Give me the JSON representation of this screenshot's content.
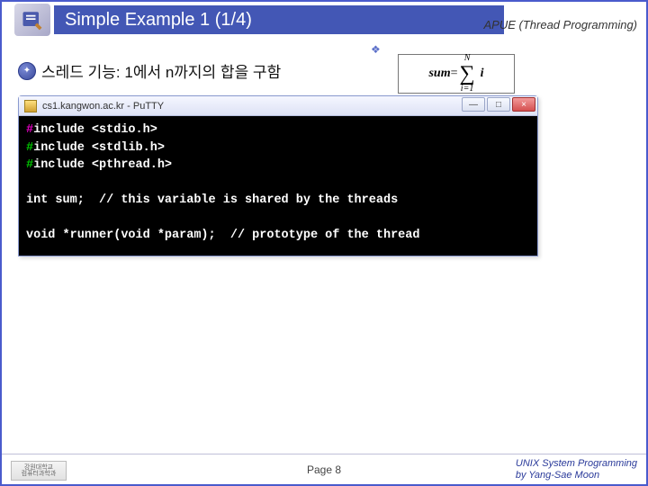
{
  "header": {
    "title": "Simple Example 1 (1/4)",
    "topic": "APUE (Thread Programming)"
  },
  "bullet": {
    "text": "스레드 기능: 1에서 n까지의 합을 구함"
  },
  "formula": {
    "lhs_italic": "sum",
    "eq": " = ",
    "upper": "N",
    "lower": "i=1",
    "rhs": "i"
  },
  "putty": {
    "title": "cs1.kangwon.ac.kr - PuTTY",
    "min_label": "—",
    "max_label": "□",
    "close_label": "×"
  },
  "terminal": {
    "l1_hash": "#",
    "l1_rest": "include <stdio.h>",
    "l2_hash": "#",
    "l2_rest": "include <stdlib.h>",
    "l3_hash": "#",
    "l3_rest": "include <pthread.h>",
    "blank": "",
    "l4": "int sum;  // this variable is shared by the threads",
    "l5": "void *runner(void *param);  // prototype of the thread"
  },
  "footer": {
    "page": "Page 8",
    "right1": "UNIX System Programming",
    "right2": "by Yang-Sae Moon",
    "logo1": "강원대학교",
    "logo2": "컴퓨터과학과"
  }
}
